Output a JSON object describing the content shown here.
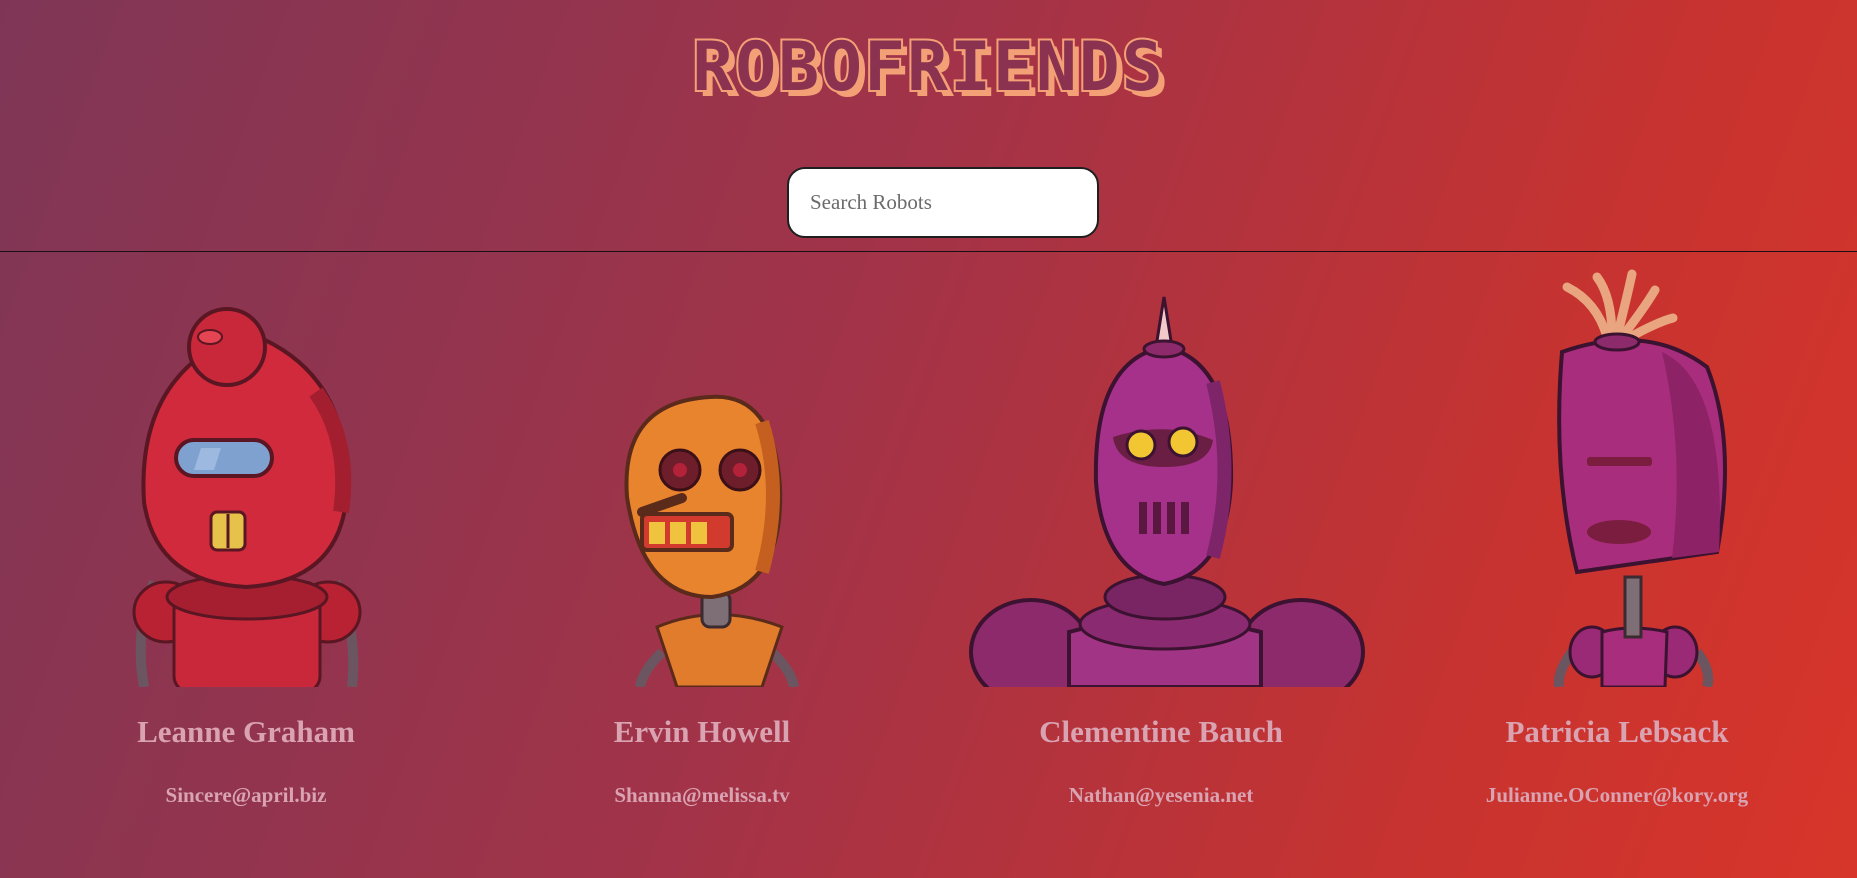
{
  "app": {
    "title": "ROBOFRIENDS"
  },
  "search": {
    "placeholder": "Search Robots",
    "value": ""
  },
  "robots": [
    {
      "name": "Leanne Graham",
      "email": "Sincere@april.biz",
      "icon": "red-robot-avatar",
      "color": "#c9283a"
    },
    {
      "name": "Ervin Howell",
      "email": "Shanna@melissa.tv",
      "icon": "orange-robot-avatar",
      "color": "#e07c2c"
    },
    {
      "name": "Clementine Bauch",
      "email": "Nathan@yesenia.net",
      "icon": "purple-robot-avatar",
      "color": "#a02f7c"
    },
    {
      "name": "Patricia Lebsack",
      "email": "Julianne.OConner@kory.org",
      "icon": "magenta-robot-avatar",
      "color": "#a82d7c"
    }
  ]
}
